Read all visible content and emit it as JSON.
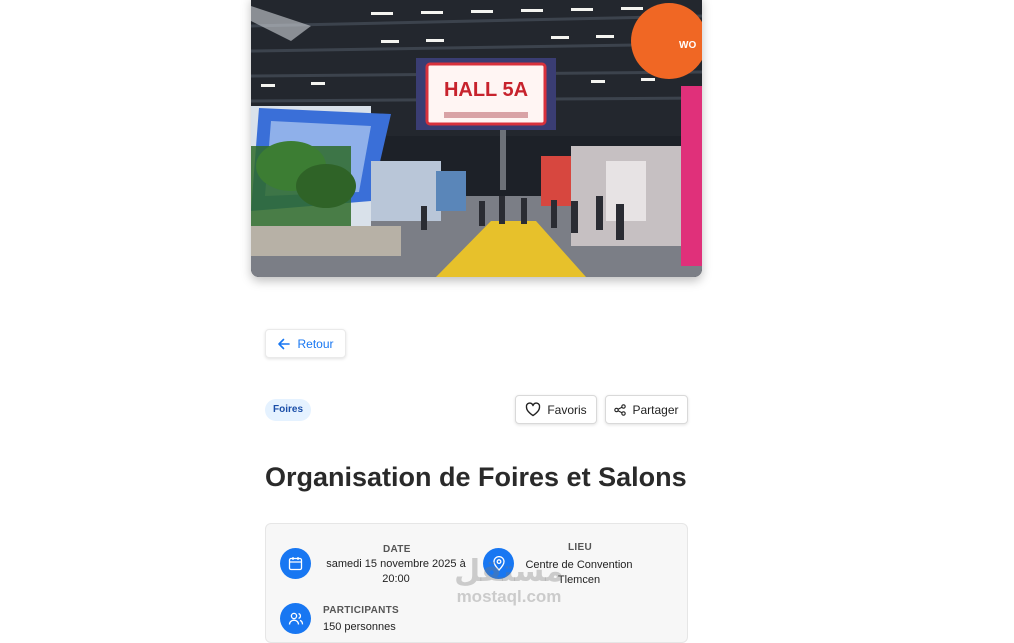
{
  "hero": {
    "hall_sign": "HALL 5A",
    "balloon_text": "WO"
  },
  "back_button": {
    "label": "Retour"
  },
  "category_badge": "Foires",
  "actions": {
    "favorite_label": "Favoris",
    "share_label": "Partager"
  },
  "event": {
    "title": "Organisation de Foires et Salons"
  },
  "details": {
    "date_label": "DATE",
    "date_line1": "samedi 15 novembre 2025 à",
    "date_line2": "20:00",
    "location_label": "LIEU",
    "location_line1": "Centre de Convention",
    "location_line2": "Tlemcen",
    "participants_label": "PARTICIPANTS",
    "participants_value": "150 personnes"
  },
  "watermark": {
    "arabic": "مستقل",
    "latin": "mostaql.com"
  },
  "colors": {
    "accent": "#1877f2",
    "badge_bg": "#e5f2ff",
    "card_bg": "#f7f7f7"
  }
}
